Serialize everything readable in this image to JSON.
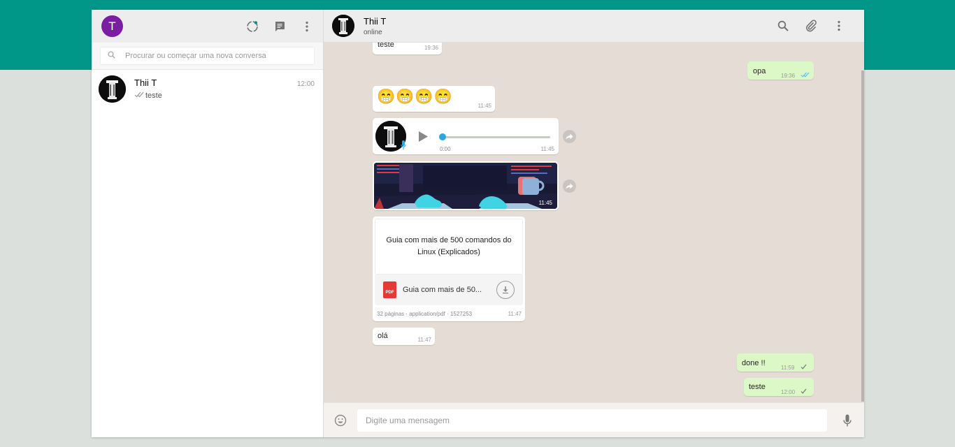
{
  "colors": {
    "brand": "#009688",
    "outgoing_bubble": "#dcf8c6",
    "read_tick": "#4fc3f7",
    "avatar_bg": "#7b1fa2"
  },
  "sidebar": {
    "my_avatar_letter": "T",
    "icons": [
      "status-icon",
      "new-chat-icon",
      "menu-icon"
    ],
    "search": {
      "placeholder": "Procurar ou começar uma nova conversa",
      "value": ""
    },
    "chats": [
      {
        "name": "Thii T",
        "time": "12:00",
        "last_message": "teste",
        "last_status": "read-ticks"
      }
    ]
  },
  "conversation": {
    "contact_name": "Thii T",
    "contact_status": "online",
    "icons": [
      "search-icon",
      "attach-icon",
      "menu-icon"
    ],
    "messages": {
      "m1": {
        "direction": "in",
        "text": "teste",
        "time": "19:36"
      },
      "m2": {
        "direction": "out",
        "text": "opa",
        "time": "19:36",
        "status": "read"
      },
      "m3": {
        "direction": "in",
        "text": "😁😁😁😁",
        "time": "11:45"
      },
      "m4": {
        "direction": "in",
        "type": "audio",
        "elapsed": "0:00",
        "time": "11:45",
        "progress": 0
      },
      "m5": {
        "direction": "in",
        "type": "image",
        "time": "11:45"
      },
      "m6": {
        "direction": "in",
        "type": "document",
        "preview_title": "Guia com mais de 500 comandos do Linux (Explicados)",
        "file_name": "Guia com mais de 50...",
        "file_icon_label": "PDF",
        "meta": "32 páginas  · application/pdf  · 1527253",
        "time": "11:47"
      },
      "m7": {
        "direction": "in",
        "text": "olá",
        "time": "11:47"
      },
      "m8": {
        "direction": "out",
        "text": "done !!",
        "time": "11:59",
        "status": "sent"
      },
      "m9": {
        "direction": "out",
        "text": "teste",
        "time": "12:00",
        "status": "sent"
      }
    }
  },
  "composer": {
    "placeholder": "Digite uma mensagem",
    "value": ""
  }
}
